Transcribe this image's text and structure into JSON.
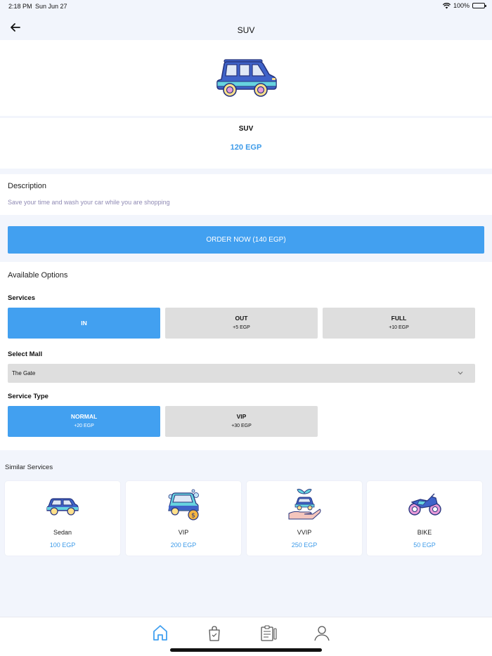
{
  "status": {
    "time": "2:18 PM",
    "date": "Sun Jun 27",
    "battery": "100%"
  },
  "header": {
    "title": "SUV"
  },
  "hero": {
    "icon": "suv-car-icon"
  },
  "product": {
    "name": "SUV",
    "price": "120 EGP"
  },
  "description": {
    "title": "Description",
    "text": "Save your time and wash your car while you are shopping"
  },
  "order": {
    "label": "ORDER NOW (140 EGP)"
  },
  "options": {
    "title": "Available Options",
    "services": {
      "label": "Services",
      "items": [
        {
          "label": "IN",
          "sub": "",
          "selected": true
        },
        {
          "label": "OUT",
          "sub": "+5 EGP",
          "selected": false
        },
        {
          "label": "FULL",
          "sub": "+10 EGP",
          "selected": false
        }
      ]
    },
    "mall": {
      "label": "Select Mall",
      "value": "The Gate"
    },
    "service_type": {
      "label": "Service Type",
      "items": [
        {
          "label": "NORMAL",
          "sub": "+20 EGP",
          "selected": true
        },
        {
          "label": "VIP",
          "sub": "+30 EGP",
          "selected": false
        }
      ]
    }
  },
  "similar": {
    "title": "Similar Services",
    "items": [
      {
        "name": "Sedan",
        "price": "100 EGP",
        "icon": "sedan-car-icon"
      },
      {
        "name": "VIP",
        "price": "200 EGP",
        "icon": "vip-car-wash-icon"
      },
      {
        "name": "VVIP",
        "price": "250 EGP",
        "icon": "vvip-car-hand-icon"
      },
      {
        "name": "BIKE",
        "price": "50 EGP",
        "icon": "motorbike-icon"
      }
    ]
  },
  "tabs": [
    {
      "name": "home",
      "icon": "home-icon",
      "active": true
    },
    {
      "name": "orders",
      "icon": "shopping-bag-icon",
      "active": false
    },
    {
      "name": "history",
      "icon": "clipboard-icon",
      "active": false
    },
    {
      "name": "profile",
      "icon": "user-icon",
      "active": false
    }
  ],
  "colors": {
    "accent": "#42a0f0",
    "price": "#3d9be9",
    "muted_text": "#8f8ab4",
    "background": "#f2f5fc",
    "option_bg": "#dedede"
  }
}
